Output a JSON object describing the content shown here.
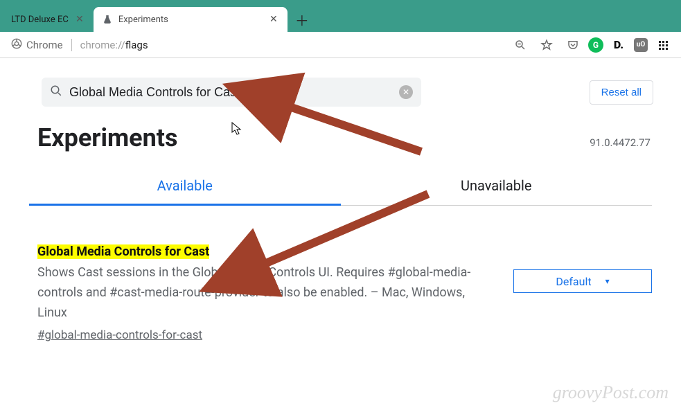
{
  "tabs": {
    "inactive": {
      "title": "LTD Deluxe EC"
    },
    "active": {
      "title": "Experiments"
    }
  },
  "addrbar": {
    "chip": "Chrome",
    "url_prefix": "chrome://",
    "url_highlight": "flags"
  },
  "search": {
    "value": "Global Media Controls for Cast"
  },
  "reset_label": "Reset all",
  "page_title": "Experiments",
  "version": "91.0.4472.77",
  "ftabs": {
    "available": "Available",
    "unavailable": "Unavailable"
  },
  "flag": {
    "title": "Global Media Controls for Cast",
    "desc": "Shows Cast sessions in the Global Media Controls UI. Requires #global-media-controls and #cast-media-route-provider to also be enabled. – Mac, Windows, Linux",
    "hash": "#global-media-controls-for-cast",
    "select_value": "Default"
  },
  "watermark": "groovyPost.com"
}
